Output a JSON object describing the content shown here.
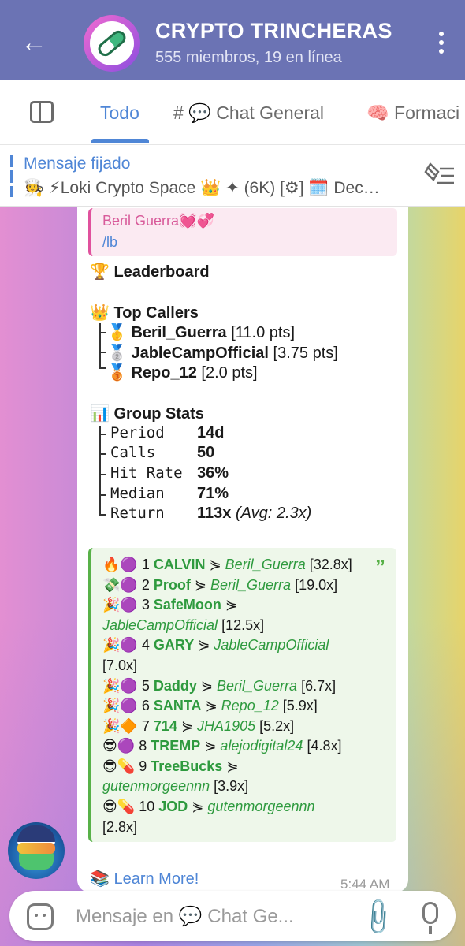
{
  "header": {
    "title": "CRYPTO TRINCHERAS",
    "subtitle": "555 miembros, 19 en línea"
  },
  "tabs": [
    {
      "label": "Todo"
    },
    {
      "label": "# 💬 Chat General"
    },
    {
      "label": "🧠 Formaci"
    }
  ],
  "pinned": {
    "label": "Mensaje fijado",
    "text": "🧑‍🍳 ⚡Loki Crypto Space 👑 ✦ (6K)  [⚙] 🗓️ Dec…"
  },
  "message": {
    "reply_name": "Beril Guerra💓💞",
    "reply_text": "/lb",
    "heading": "🏆 Leaderboard",
    "top_callers_title": "👑 Top Callers",
    "top_callers": [
      {
        "medal": "🥇",
        "name": "Beril_Guerra",
        "pts": "[11.0 pts]"
      },
      {
        "medal": "🥈",
        "name": "JableCampOfficial",
        "pts": "[3.75 pts]"
      },
      {
        "medal": "🥉",
        "name": "Repo_12",
        "pts": "[2.0 pts]"
      }
    ],
    "stats_title": "📊 Group Stats",
    "stats": [
      {
        "label": "Period",
        "value": "14d",
        "extra": ""
      },
      {
        "label": "Calls",
        "value": "50",
        "extra": ""
      },
      {
        "label": "Hit Rate",
        "value": "36%",
        "extra": ""
      },
      {
        "label": "Median",
        "value": "71%",
        "extra": ""
      },
      {
        "label": "Return",
        "value": "113x",
        "extra": "(Avg: 2.3x)"
      }
    ],
    "calls": [
      {
        "emoji": "🔥🟣",
        "rank": "1",
        "token": "CALVIN",
        "sep": "⋟",
        "user": "Beril_Guerra",
        "mult": "[32.8x]",
        "wrap": false
      },
      {
        "emoji": "💸🟣",
        "rank": "2",
        "token": "Proof",
        "sep": "⋟",
        "user": "Beril_Guerra",
        "mult": "[19.0x]",
        "wrap": false
      },
      {
        "emoji": "🎉🟣",
        "rank": "3",
        "token": "SafeMoon",
        "sep": "⋟",
        "user": "JableCampOfficial",
        "mult": "[12.5x]",
        "wrap": true
      },
      {
        "emoji": "🎉🟣",
        "rank": "4",
        "token": "GARY",
        "sep": "⋟",
        "user": "JableCampOfficial",
        "mult": "[7.0x]",
        "wrap": "mult"
      },
      {
        "emoji": "🎉🟣",
        "rank": "5",
        "token": "Daddy",
        "sep": "⋟",
        "user": "Beril_Guerra",
        "mult": "[6.7x]",
        "wrap": false
      },
      {
        "emoji": "🎉🟣",
        "rank": "6",
        "token": "SANTA",
        "sep": "⋟",
        "user": "Repo_12",
        "mult": "[5.9x]",
        "wrap": false
      },
      {
        "emoji": "🎉🔶",
        "rank": "7",
        "token": "714",
        "sep": "⋟",
        "user": "JHA1905",
        "mult": "[5.2x]",
        "wrap": false
      },
      {
        "emoji": "😎🟣",
        "rank": "8",
        "token": "TREMP",
        "sep": "⋟",
        "user": "alejodigital24",
        "mult": "[4.8x]",
        "wrap": false
      },
      {
        "emoji": "😎💊",
        "rank": "9",
        "token": "TreeBucks",
        "sep": "⋟",
        "user": "gutenmorgeennn",
        "mult": "[3.9x]",
        "wrap": true
      },
      {
        "emoji": "😎💊",
        "rank": "10",
        "token": "JOD",
        "sep": "⋟",
        "user": "gutenmorgeennn",
        "mult": "[2.8x]",
        "wrap": "mult"
      }
    ],
    "learn_more": "📚 Learn More!",
    "time": "5:44 AM"
  },
  "input": {
    "placeholder": "Mensaje en 💬 Chat Ge..."
  },
  "colors": {
    "header_bg": "#6b73b4",
    "accent": "#4f86d6",
    "quote_green": "#58b148",
    "reply_pink": "#e0519d"
  }
}
